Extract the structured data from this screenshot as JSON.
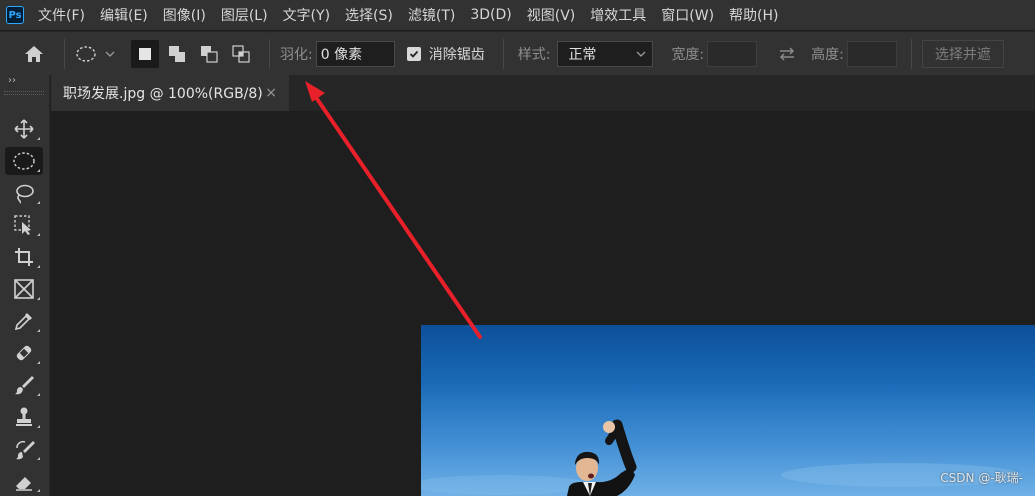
{
  "app": {
    "logo_text": "Ps"
  },
  "menu": {
    "items": [
      "文件(F)",
      "编辑(E)",
      "图像(I)",
      "图层(L)",
      "文字(Y)",
      "选择(S)",
      "滤镜(T)",
      "3D(D)",
      "视图(V)",
      "增效工具",
      "窗口(W)",
      "帮助(H)"
    ]
  },
  "options": {
    "feather_label": "羽化:",
    "feather_value": "0 像素",
    "antialias_label": "消除锯齿",
    "antialias_checked": true,
    "style_label": "样式:",
    "style_value": "正常",
    "width_label": "宽度:",
    "height_label": "高度:",
    "select_and_mask_label": "选择并遮"
  },
  "toolbar": {
    "collapse_glyph": "››",
    "tools": [
      "move-tool",
      "elliptical-marquee-tool",
      "lasso-tool",
      "object-selection-tool",
      "crop-tool",
      "frame-tool",
      "eyedropper-tool",
      "spot-healing-brush-tool",
      "brush-tool",
      "clone-stamp-tool",
      "history-brush-tool",
      "eraser-tool"
    ],
    "active_tool": "elliptical-marquee-tool"
  },
  "document": {
    "tab_title": "职场发展.jpg @ 100%(RGB/8)",
    "close_glyph": "×"
  },
  "watermark": "CSDN @-耿瑞-",
  "colors": {
    "arrow": "#e8202a",
    "sky_top": "#0d4f99",
    "sky_bottom": "#6fb0e6"
  }
}
